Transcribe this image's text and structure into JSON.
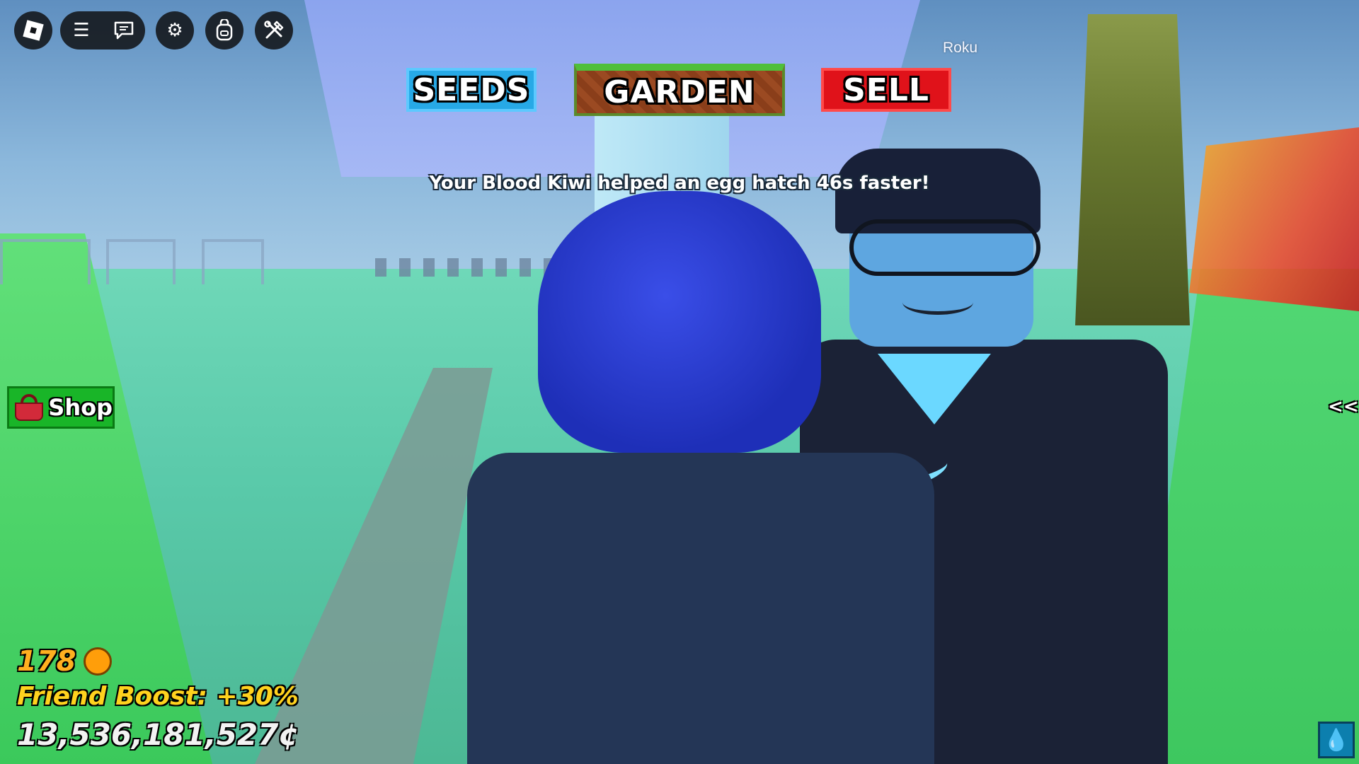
{
  "topbar": {
    "icons": [
      "roblox-logo-icon",
      "menu-icon",
      "chat-icon",
      "gear-icon",
      "backpack-icon",
      "tools-icon"
    ]
  },
  "nav": {
    "seeds_label": "SEEDS",
    "garden_label": "GARDEN",
    "sell_label": "SELL"
  },
  "notification": "Your Blood Kiwi helped an egg hatch 46s faster!",
  "player": {
    "name": "Roku"
  },
  "shop": {
    "label": "Shop"
  },
  "side_toggle": "<<",
  "stats": {
    "honey": "178",
    "friend_boost": "Friend Boost: +30%",
    "money": "13,536,181,527¢"
  },
  "colors": {
    "seeds": "#27a9e6",
    "garden": "#9b4a22",
    "sell": "#e0121a",
    "shop": "#19b528",
    "honey": "#ffb020",
    "boost": "#ffd21e"
  }
}
